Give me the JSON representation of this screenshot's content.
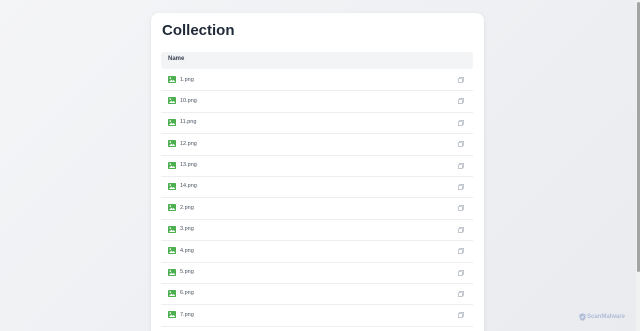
{
  "page": {
    "title": "Collection"
  },
  "table": {
    "header_name": "Name",
    "files": [
      {
        "name": "1.png"
      },
      {
        "name": "10.png"
      },
      {
        "name": "11.png"
      },
      {
        "name": "12.png"
      },
      {
        "name": "13.png"
      },
      {
        "name": "14.png"
      },
      {
        "name": "2.png"
      },
      {
        "name": "3.png"
      },
      {
        "name": "4.png"
      },
      {
        "name": "5.png"
      },
      {
        "name": "6.png"
      },
      {
        "name": "7.png"
      }
    ]
  },
  "watermark": {
    "text": "ScanMalware"
  },
  "colors": {
    "image_icon": "#4caf50",
    "copy_icon": "#9ca3af",
    "title": "#1f2937"
  },
  "icons": {
    "file": "image-file-icon",
    "copy": "copy-icon"
  }
}
